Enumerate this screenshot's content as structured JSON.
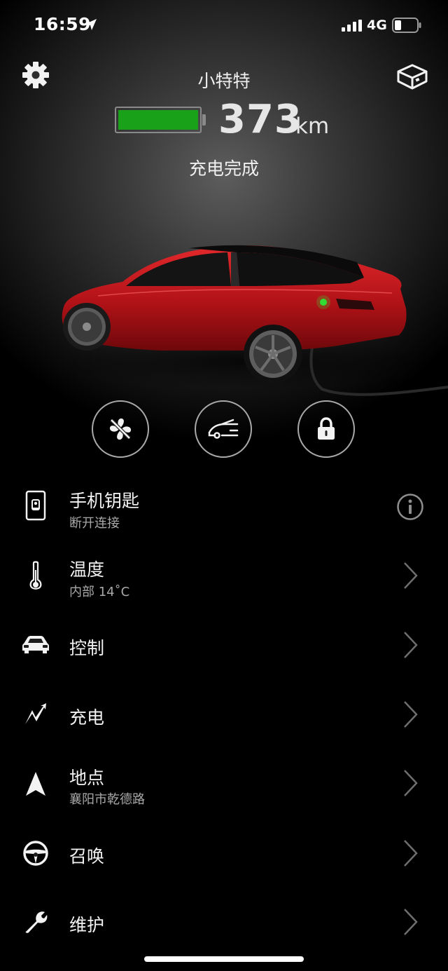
{
  "status_bar": {
    "time": "16:59",
    "network": "4G"
  },
  "header": {
    "car_name": "小特特",
    "range_value": "373",
    "range_unit": "km",
    "charge_status": "充电完成",
    "battery_level": 1.0,
    "battery_color": "#1aa11a"
  },
  "quick_actions": [
    {
      "icon": "fan-icon"
    },
    {
      "icon": "trunk-icon"
    },
    {
      "icon": "lock-icon"
    }
  ],
  "menu": {
    "phone_key": {
      "title": "手机钥匙",
      "subtitle": "断开连接",
      "icon": "phone-key-icon"
    },
    "climate": {
      "title": "温度",
      "subtitle": "内部 14˚C",
      "icon": "thermometer-icon"
    },
    "controls": {
      "title": "控制",
      "icon": "car-icon"
    },
    "charging": {
      "title": "充电",
      "icon": "bolt-icon"
    },
    "location": {
      "title": "地点",
      "subtitle": "襄阳市乾德路",
      "icon": "navigation-arrow-icon"
    },
    "summon": {
      "title": "召唤",
      "icon": "steering-wheel-icon"
    },
    "service": {
      "title": "维护",
      "icon": "wrench-icon"
    }
  },
  "colors": {
    "car_body": "#c0141a",
    "accent_green": "#1aa11a"
  }
}
